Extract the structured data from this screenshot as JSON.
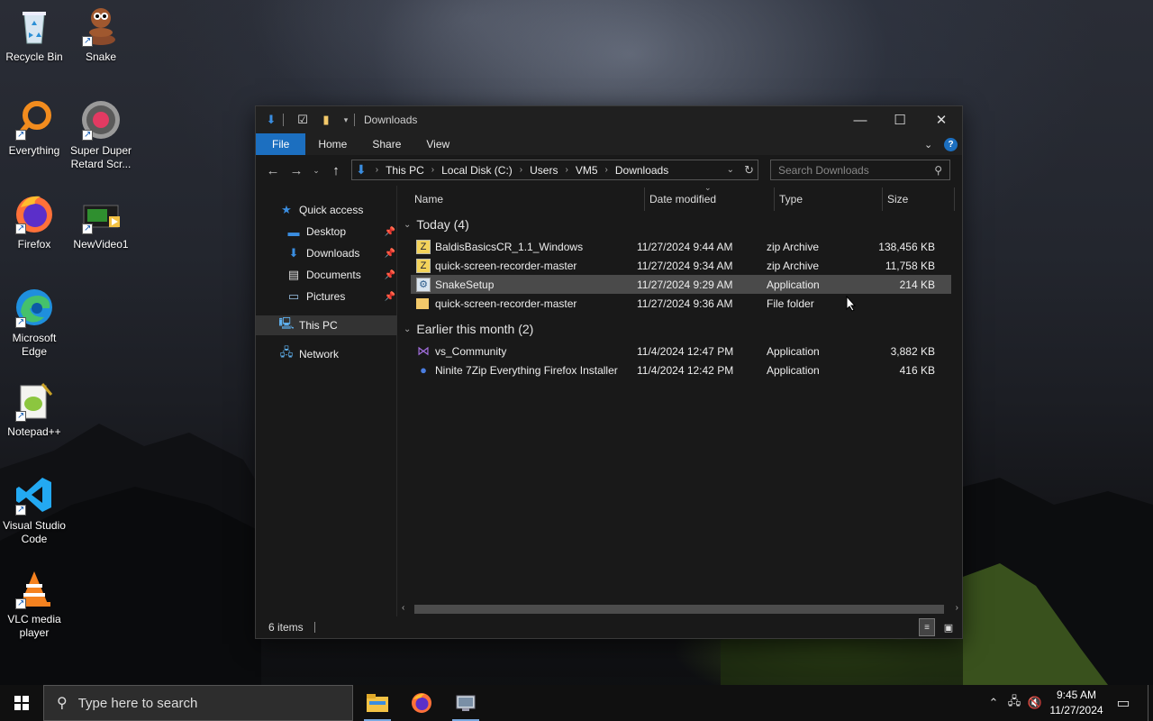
{
  "desktop": {
    "icons": [
      {
        "label": "Recycle Bin",
        "icon": "recycle-bin-icon"
      },
      {
        "label": "Snake",
        "icon": "snake-icon"
      },
      {
        "label": "Everything",
        "icon": "everything-search-icon"
      },
      {
        "label": "Super Duper Retard Scr...",
        "icon": "recorder-icon"
      },
      {
        "label": "Firefox",
        "icon": "firefox-icon"
      },
      {
        "label": "NewVideo1",
        "icon": "video-file-icon"
      },
      {
        "label": "Microsoft Edge",
        "icon": "edge-icon"
      },
      {
        "label": "Notepad++",
        "icon": "notepadpp-icon"
      },
      {
        "label": "Visual Studio Code",
        "icon": "vscode-icon"
      },
      {
        "label": "VLC media player",
        "icon": "vlc-icon"
      }
    ]
  },
  "explorer": {
    "title": "Downloads",
    "ribbon_tabs": [
      "File",
      "Home",
      "Share",
      "View"
    ],
    "address": {
      "crumbs": [
        "This PC",
        "Local Disk (C:)",
        "Users",
        "VM5",
        "Downloads"
      ]
    },
    "search_placeholder": "Search Downloads",
    "nav": {
      "quick_access": "Quick access",
      "pinned": [
        {
          "label": "Desktop",
          "icon": "desktop-folder-icon"
        },
        {
          "label": "Downloads",
          "icon": "downloads-folder-icon"
        },
        {
          "label": "Documents",
          "icon": "documents-folder-icon"
        },
        {
          "label": "Pictures",
          "icon": "pictures-folder-icon"
        }
      ],
      "this_pc": "This PC",
      "network": "Network"
    },
    "columns": {
      "name": "Name",
      "date": "Date modified",
      "type": "Type",
      "size": "Size"
    },
    "groups": [
      {
        "label": "Today (4)",
        "files": [
          {
            "name": "BaldisBasicsCR_1.1_Windows",
            "date": "11/27/2024 9:44 AM",
            "type": "zip Archive",
            "size": "138,456 KB",
            "icon": "zip-icon"
          },
          {
            "name": "quick-screen-recorder-master",
            "date": "11/27/2024 9:34 AM",
            "type": "zip Archive",
            "size": "11,758 KB",
            "icon": "zip-icon"
          },
          {
            "name": "SnakeSetup",
            "date": "11/27/2024 9:29 AM",
            "type": "Application",
            "size": "214 KB",
            "icon": "installer-icon"
          },
          {
            "name": "quick-screen-recorder-master",
            "date": "11/27/2024 9:36 AM",
            "type": "File folder",
            "size": "",
            "icon": "folder-icon"
          }
        ]
      },
      {
        "label": "Earlier this month (2)",
        "files": [
          {
            "name": "vs_Community",
            "date": "11/4/2024 12:47 PM",
            "type": "Application",
            "size": "3,882 KB",
            "icon": "visual-studio-icon"
          },
          {
            "name": "Ninite 7Zip Everything Firefox Installer",
            "date": "11/4/2024 12:42 PM",
            "type": "Application",
            "size": "416 KB",
            "icon": "ninite-icon"
          }
        ]
      }
    ],
    "status": "6 items"
  },
  "taskbar": {
    "search_placeholder": "Type here to search",
    "time": "9:45 AM",
    "date": "11/27/2024"
  },
  "colors": {
    "accent": "#1c6fc0",
    "window_bg": "#191919",
    "selected_row": "#4a4a4a"
  }
}
